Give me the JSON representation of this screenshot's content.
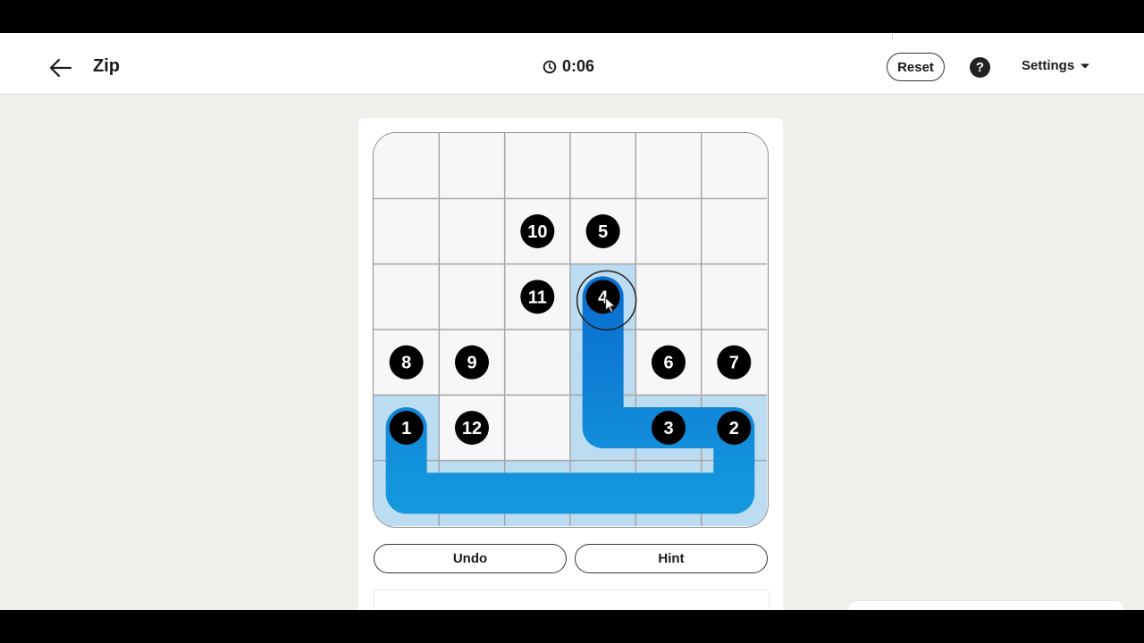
{
  "header": {
    "title": "Zip",
    "timer": "0:06",
    "reset_label": "Reset",
    "help_label": "?",
    "settings_label": "Settings"
  },
  "icons": {
    "back": "arrow-left-icon",
    "timer": "clock-icon",
    "help": "question-icon",
    "settings_caret": "caret-down-icon"
  },
  "board": {
    "rows": 6,
    "cols": 6,
    "nodes": [
      {
        "label": "10",
        "row": 1,
        "col": 2
      },
      {
        "label": "5",
        "row": 1,
        "col": 3
      },
      {
        "label": "11",
        "row": 2,
        "col": 2
      },
      {
        "label": "4",
        "row": 2,
        "col": 3
      },
      {
        "label": "8",
        "row": 3,
        "col": 0
      },
      {
        "label": "9",
        "row": 3,
        "col": 1
      },
      {
        "label": "6",
        "row": 3,
        "col": 4
      },
      {
        "label": "7",
        "row": 3,
        "col": 5
      },
      {
        "label": "1",
        "row": 4,
        "col": 0
      },
      {
        "label": "12",
        "row": 4,
        "col": 1
      },
      {
        "label": "3",
        "row": 4,
        "col": 4
      },
      {
        "label": "2",
        "row": 4,
        "col": 5
      }
    ],
    "path": [
      [
        4,
        0
      ],
      [
        5,
        0
      ],
      [
        5,
        1
      ],
      [
        5,
        2
      ],
      [
        5,
        3
      ],
      [
        5,
        4
      ],
      [
        5,
        5
      ],
      [
        4,
        5
      ],
      [
        4,
        4
      ],
      [
        4,
        3
      ],
      [
        3,
        3
      ],
      [
        2,
        3
      ]
    ],
    "active_node": "4"
  },
  "controls": {
    "undo_label": "Undo",
    "hint_label": "Hint"
  },
  "colors": {
    "path": "#1282d6",
    "visited_cell": "#bcdcf2",
    "node": "#000000",
    "background": "#f0efeb"
  }
}
